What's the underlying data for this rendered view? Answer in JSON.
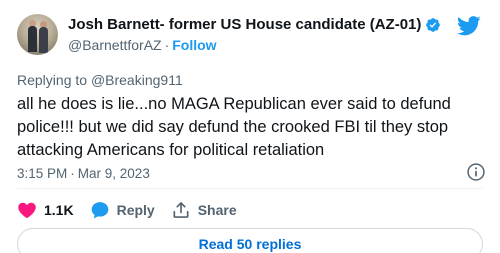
{
  "author": {
    "display_name": "Josh Barnett- former US House candidate (AZ-01)",
    "handle": "@BarnettforAZ",
    "separator": "·",
    "follow_label": "Follow"
  },
  "reply_to": {
    "prefix": "Replying to",
    "mention": "@Breaking911"
  },
  "tweet": {
    "text": "all he does is lie...no MAGA Republican ever said to defund police!!! but we did say defund the crooked FBI til they stop attacking Americans for political retaliation",
    "time": "3:15 PM",
    "separator": "·",
    "date": "Mar 9, 2023"
  },
  "actions": {
    "likes": "1.1K",
    "reply_label": "Reply",
    "share_label": "Share"
  },
  "read_replies_label": "Read 50 replies",
  "colors": {
    "accent": "#1d9bf0",
    "like": "#f91880",
    "muted": "#536471",
    "text": "#0f1419"
  }
}
